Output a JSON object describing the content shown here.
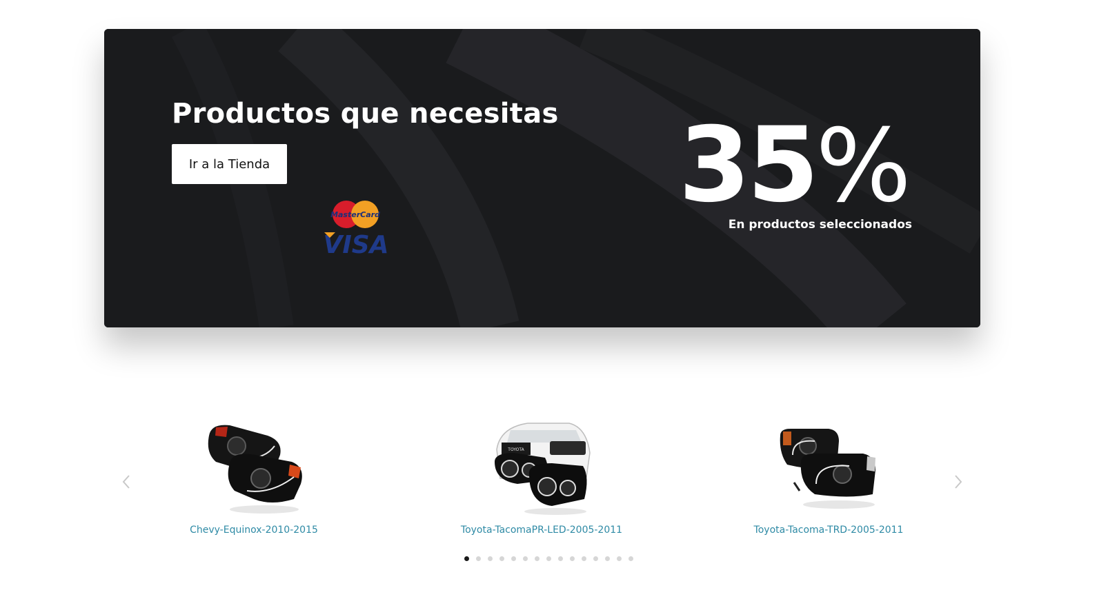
{
  "banner": {
    "title": "Productos que necesitas",
    "button_label": "Ir a la Tienda",
    "discount_number": "35",
    "discount_symbol": "%",
    "discount_caption": "En productos seleccionados",
    "card_brands": [
      "MasterCard",
      "VISA"
    ]
  },
  "carousel": {
    "products": [
      {
        "name": "Chevy-Equinox-2010-2015",
        "image_icon": "black-headlight-pair-image"
      },
      {
        "name": "Toyota-TacomaPR-LED-2005-2011",
        "image_icon": "white-truck-headlight-pair-image"
      },
      {
        "name": "Toyota-Tacoma-TRD-2005-2011",
        "image_icon": "black-headlight-pair-image"
      }
    ],
    "page_count": 15,
    "active_page": 1
  },
  "colors": {
    "banner_background": "#1d1e20",
    "link_text": "#2e8aa5",
    "active_dot": "#1a1a1a",
    "inactive_dot": "#d6d6d6"
  }
}
